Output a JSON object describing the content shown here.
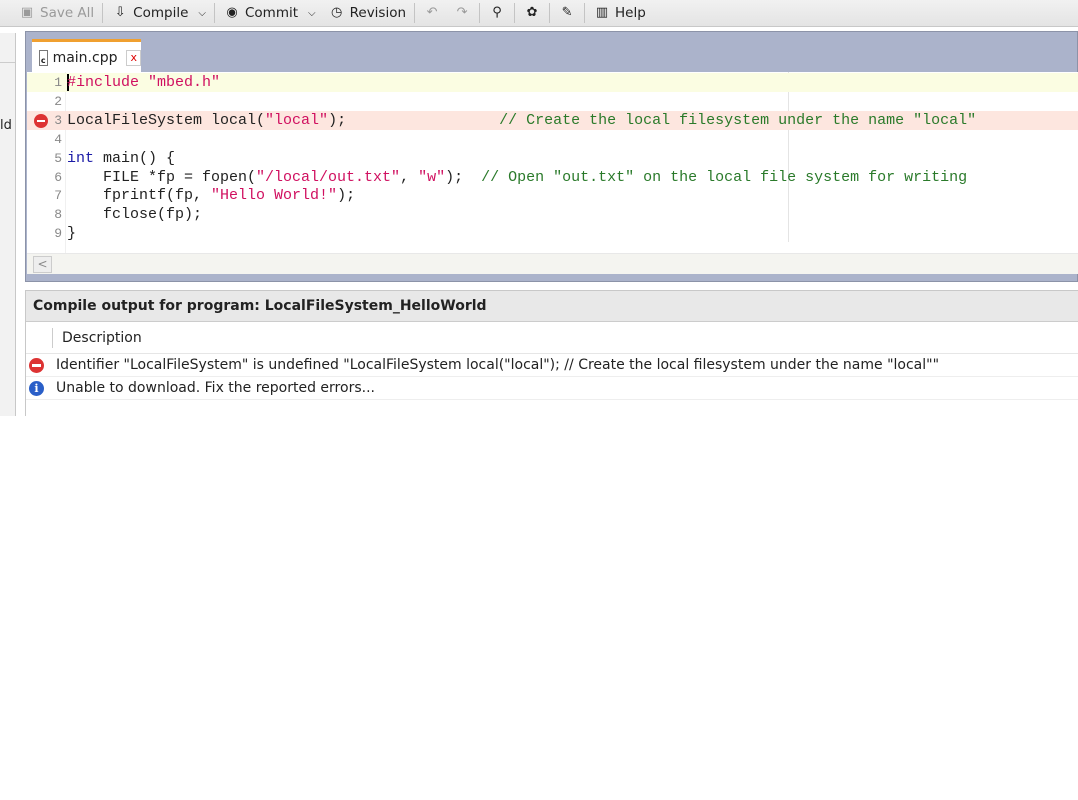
{
  "toolbar": {
    "items": [
      {
        "label": "Save All",
        "icon": "save-icon",
        "glyph": "▣",
        "disabled": true
      },
      {
        "label": "Compile",
        "icon": "compile-icon",
        "glyph": "⇩",
        "dropdown": true
      },
      {
        "label": "Commit",
        "icon": "commit-icon",
        "glyph": "◉",
        "dropdown": true
      },
      {
        "label": "Revision",
        "icon": "revision-icon",
        "glyph": "◷"
      },
      {
        "label": "",
        "icon": "undo-icon",
        "glyph": "↶",
        "disabled": true
      },
      {
        "label": "",
        "icon": "redo-icon",
        "glyph": "↷",
        "disabled": true
      },
      {
        "label": "",
        "icon": "binoculars-icon",
        "glyph": "⚲"
      },
      {
        "label": "",
        "icon": "package-icon",
        "glyph": "✿"
      },
      {
        "label": "",
        "icon": "magic-wand-icon",
        "glyph": "✎"
      },
      {
        "label": "Help",
        "icon": "help-book-icon",
        "glyph": "▥"
      }
    ]
  },
  "left_panel": {
    "partial_text": "ld"
  },
  "editor": {
    "tab": {
      "label": "main.cpp",
      "close": "x"
    },
    "lines": [
      {
        "n": "1",
        "state": "current",
        "tokens": [
          {
            "t": "#include \"mbed.h\"",
            "c": "p"
          }
        ]
      },
      {
        "n": "2",
        "tokens": []
      },
      {
        "n": "3",
        "state": "error",
        "tokens": [
          {
            "t": "LocalFileSystem local(",
            "c": "n"
          },
          {
            "t": "\"local\"",
            "c": "s"
          },
          {
            "t": ");                 ",
            "c": "n"
          },
          {
            "t": "// Create the local filesystem under the name \"local\"",
            "c": "c"
          }
        ]
      },
      {
        "n": "4",
        "tokens": []
      },
      {
        "n": "5",
        "tokens": [
          {
            "t": "int",
            "c": "k"
          },
          {
            "t": " main() {",
            "c": "n"
          }
        ]
      },
      {
        "n": "6",
        "tokens": [
          {
            "t": "    FILE *fp = fopen(",
            "c": "n"
          },
          {
            "t": "\"/local/out.txt\"",
            "c": "s"
          },
          {
            "t": ", ",
            "c": "n"
          },
          {
            "t": "\"w\"",
            "c": "s"
          },
          {
            "t": ");  ",
            "c": "n"
          },
          {
            "t": "// Open \"out.txt\" on the local file system for writing",
            "c": "c"
          }
        ]
      },
      {
        "n": "7",
        "tokens": [
          {
            "t": "    fprintf(fp, ",
            "c": "n"
          },
          {
            "t": "\"Hello World!\"",
            "c": "s"
          },
          {
            "t": ");",
            "c": "n"
          }
        ]
      },
      {
        "n": "8",
        "tokens": [
          {
            "t": "    fclose(fp);",
            "c": "n"
          }
        ]
      },
      {
        "n": "9",
        "tokens": [
          {
            "t": "}",
            "c": "n"
          }
        ]
      }
    ]
  },
  "output": {
    "title": "Compile output for program: LocalFileSystem_HelloWorld",
    "column": "Description",
    "rows": [
      {
        "type": "error",
        "text": "Identifier \"LocalFileSystem\" is undefined \"LocalFileSystem local(\"local\"); // Create the local filesystem under the name \"local\"\""
      },
      {
        "type": "info",
        "text": "Unable to download. Fix the reported errors..."
      }
    ]
  }
}
